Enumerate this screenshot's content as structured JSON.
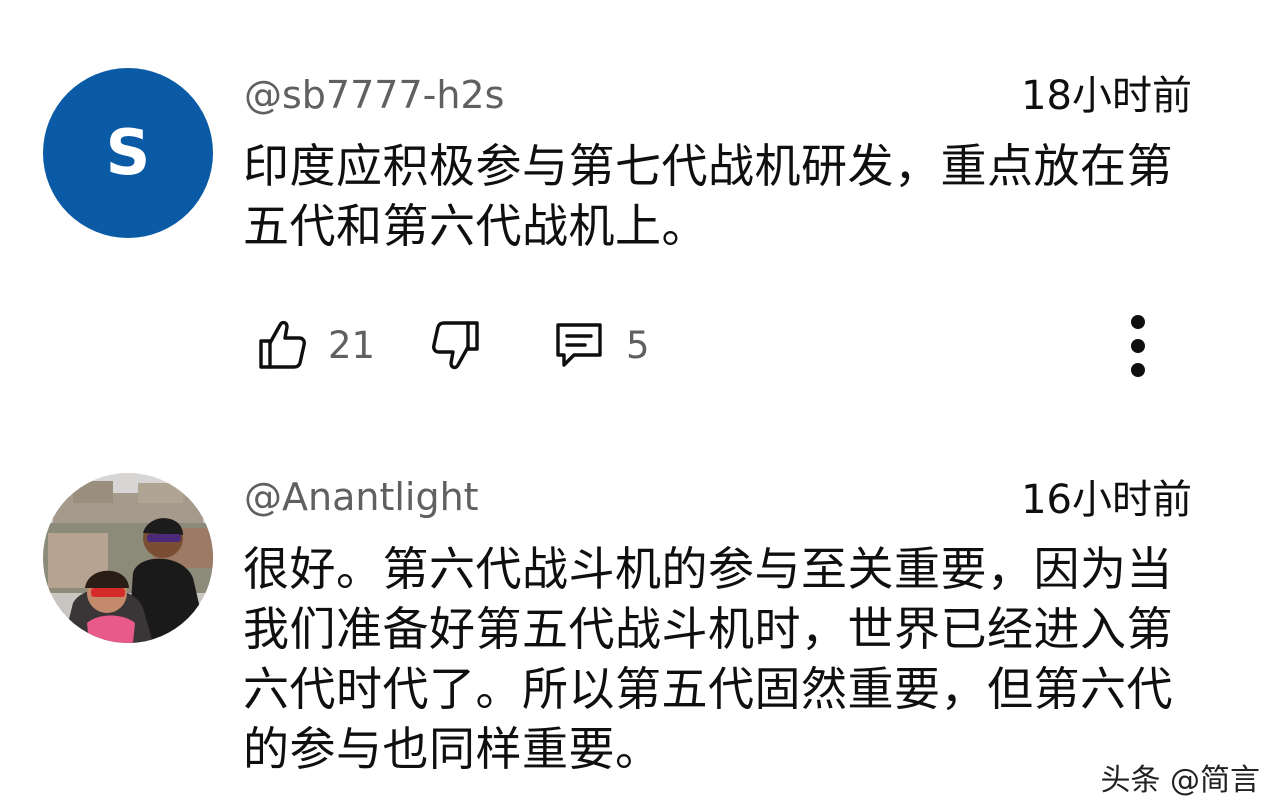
{
  "comments": [
    {
      "avatar_letter": "S",
      "avatar_color": "#0b5aa5",
      "username": "@sb7777-h2s",
      "time": "18小时前",
      "text": "印度应积极参与第七代战机研发，重点放在第五代和第六代战机上。",
      "likes": "21",
      "replies": "5"
    },
    {
      "avatar_type": "photo",
      "username": "@Anantlight",
      "time": "16小时前",
      "text": "很好。第六代战斗机的参与至关重要，因为当我们准备好第五代战斗机时，世界已经进入第六代时代了。所以第五代固然重要，但第六代的参与也同样重要。"
    }
  ],
  "icons": {
    "like": "thumbs-up-icon",
    "dislike": "thumbs-down-icon",
    "reply": "comment-icon",
    "more": "more-vertical-icon"
  },
  "watermark": "头条 @简言"
}
